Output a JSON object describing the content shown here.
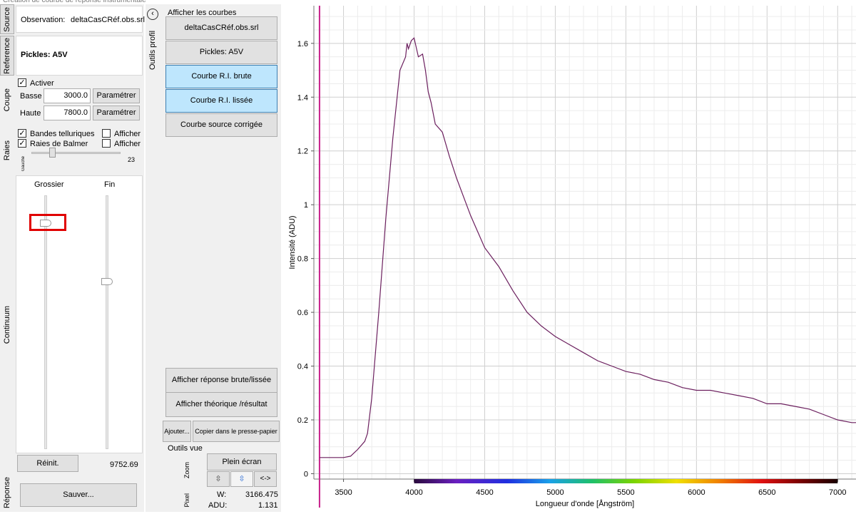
{
  "window": {
    "title": "Création de courbe de réponse instrumentale"
  },
  "tabs": {
    "source": "Source",
    "reference": "Reference",
    "coupe": "Coupe",
    "raies": "Raies",
    "continuum": "Continuum",
    "reponse": "Réponse"
  },
  "observation": {
    "label": "Observation:",
    "value": "deltaCasCRéf.obs.srl"
  },
  "pickles": {
    "label": "Pickles: A5V"
  },
  "coupe": {
    "activer_label": "Activer",
    "activer_checked": true,
    "basse_label": "Basse",
    "basse_value": "3000.0",
    "haute_label": "Haute",
    "haute_value": "7800.0",
    "parametrer_label": "Paramétrer"
  },
  "raies": {
    "bandes_label": "Bandes telluriques",
    "bandes_checked": true,
    "balmer_label": "Raies de Balmer",
    "balmer_checked": true,
    "afficher_label": "Afficher",
    "afficher1_checked": false,
    "afficher2_checked": false,
    "gauche_label": "Gauche",
    "slider_value": "23",
    "slider_fraction": 0.2
  },
  "continuum": {
    "grossier_label": "Grossier",
    "fin_label": "Fin",
    "grossier_fraction": 0.11,
    "fin_fraction": 0.34,
    "reinit_label": "Réinit.",
    "value": "9752.69"
  },
  "sauver_label": "Sauver...",
  "mid": {
    "outils_profil": "Outils profil",
    "afficher_courbes": "Afficher les courbes",
    "curve_buttons": [
      {
        "label": "deltaCasCRéf.obs.srl",
        "selected": false
      },
      {
        "label": "Pickles: A5V",
        "selected": false
      },
      {
        "label": "Courbe R.I. brute",
        "selected": true
      },
      {
        "label": "Courbe R.I. lissée",
        "selected": true
      },
      {
        "label": "Courbe source corrigée",
        "selected": false
      }
    ],
    "afficher_reponse": "Afficher réponse brute/lissée",
    "afficher_theorique": "Afficher théorique /résultat",
    "ajouter": "Ajouter...",
    "copier": "Copier dans le presse-papier",
    "outils_vue": "Outils vue",
    "zoom_label": "Zoom",
    "plein_ecran": "Plein écran",
    "zoom_v": "⇳",
    "zoom_v2": "⇳",
    "zoom_h": "<->",
    "pixel_label": "Pixel",
    "w_label": "W:",
    "w_value": "3166.475",
    "adu_label": "ADU:",
    "adu_value": "1.131"
  },
  "colors": {
    "curve": "#6b1f5e",
    "selected": "#bee6fd",
    "highlight": "#e00000",
    "cursor_line": "#c8208a"
  },
  "chart_data": {
    "type": "line",
    "xlabel": "Longueur d'onde [Ångström]",
    "ylabel": "Intensité (ADU)",
    "xlim": [
      3290,
      7130
    ],
    "ylim": [
      -0.02,
      1.74
    ],
    "xticks": [
      3500,
      4000,
      4500,
      5000,
      5500,
      6000,
      6500,
      7000
    ],
    "yticks": [
      0,
      0.2,
      0.4,
      0.6,
      0.8,
      1,
      1.2,
      1.4,
      1.6
    ],
    "ytick_labels": [
      "0",
      "0.2",
      "0.4",
      "0.6",
      "0.8",
      "1",
      "1.2",
      "1.4",
      "1.6"
    ],
    "grid": true,
    "cursor_x": 3330,
    "spectrum_bar": {
      "from": 4000,
      "to": 7000
    },
    "series": [
      {
        "x": [
          3330,
          3350,
          3400,
          3450,
          3500,
          3550,
          3600,
          3650,
          3670,
          3700,
          3750,
          3800,
          3850,
          3900,
          3940,
          3950,
          3960,
          3980,
          4000,
          4030,
          4060,
          4080,
          4100,
          4120,
          4150,
          4200,
          4250,
          4300,
          4350,
          4400,
          4450,
          4500,
          4600,
          4700,
          4800,
          4900,
          5000,
          5100,
          5200,
          5300,
          5400,
          5500,
          5600,
          5700,
          5800,
          5900,
          6000,
          6100,
          6200,
          6300,
          6400,
          6500,
          6600,
          6700,
          6800,
          6900,
          7000,
          7100,
          7130
        ],
        "y": [
          0.06,
          0.06,
          0.06,
          0.06,
          0.06,
          0.065,
          0.09,
          0.12,
          0.15,
          0.28,
          0.6,
          0.95,
          1.25,
          1.5,
          1.55,
          1.6,
          1.58,
          1.61,
          1.62,
          1.55,
          1.56,
          1.5,
          1.42,
          1.38,
          1.3,
          1.27,
          1.18,
          1.1,
          1.03,
          0.96,
          0.9,
          0.84,
          0.77,
          0.68,
          0.6,
          0.55,
          0.51,
          0.48,
          0.45,
          0.42,
          0.4,
          0.38,
          0.37,
          0.35,
          0.34,
          0.32,
          0.31,
          0.31,
          0.3,
          0.29,
          0.28,
          0.26,
          0.26,
          0.25,
          0.24,
          0.22,
          0.2,
          0.19,
          0.19
        ]
      }
    ]
  }
}
